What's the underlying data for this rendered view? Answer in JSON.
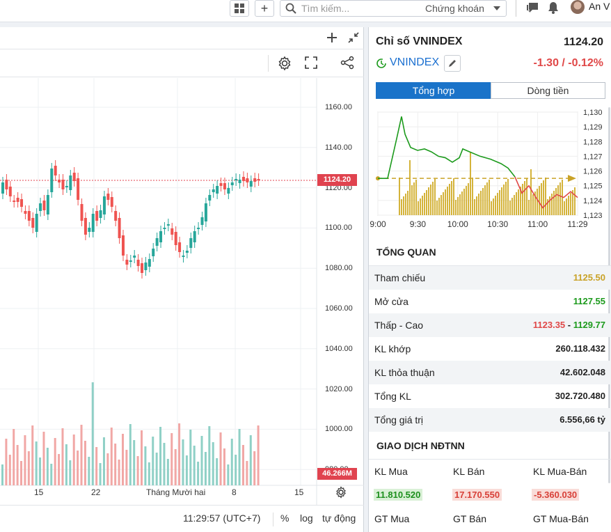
{
  "topbar": {
    "search_placeholder": "Tìm kiếm...",
    "search_scope": "Chứng khoán",
    "user_name": "An V"
  },
  "chart": {
    "price_axis": [
      "1160.00",
      "1140.00",
      "1120.00",
      "1100.00",
      "1080.00",
      "1060.00",
      "1040.00",
      "1020.00",
      "1000.00",
      "980.00"
    ],
    "last_price_label": "1124.20",
    "volume_label": "46.266M",
    "date_labels": [
      "15",
      "22",
      "Tháng Mười hai",
      "8",
      "15"
    ],
    "time_text": "11:29:57 (UTC+7)",
    "percent_label": "%",
    "log_label": "log",
    "auto_label": "tự động",
    "up_color": "#26a69a",
    "down_color": "#ef5350"
  },
  "index": {
    "title": "Chỉ số VNINDEX",
    "value": "1124.20",
    "symbol": "VNINDEX",
    "change": "-1.30 / -0.12%"
  },
  "tabs": [
    "Tổng hợp",
    "Dòng tiền"
  ],
  "intraday": {
    "y_labels": [
      "1,130",
      "1,129",
      "1,128",
      "1,127",
      "1,126",
      "1,125",
      "1,124",
      "1,123"
    ],
    "x_labels": [
      "9:00",
      "9:30",
      "10:00",
      "10:30",
      "11:00",
      "11:29"
    ],
    "reference": 1125.5
  },
  "overview": {
    "title": "TỔNG QUAN",
    "rows": [
      {
        "label": "Tham chiếu",
        "value": "1125.50"
      },
      {
        "label": "Mở cửa",
        "value": "1127.55"
      },
      {
        "label": "Thấp - Cao",
        "low": "1123.35",
        "sep": " - ",
        "high": "1129.77"
      },
      {
        "label": "KL khớp",
        "value": "260.118.432"
      },
      {
        "label": "KL thỏa thuận",
        "value": "42.602.048"
      },
      {
        "label": "Tổng KL",
        "value": "302.720.480"
      },
      {
        "label": "Tổng giá trị",
        "value": "6.556,66 tỷ"
      }
    ]
  },
  "foreign": {
    "title": "GIAO DỊCH NĐTNN",
    "headers": [
      "KL Mua",
      "KL Bán",
      "KL Mua-Bán"
    ],
    "values": [
      "11.810.520",
      "17.170.550",
      "-5.360.030"
    ],
    "headers2": [
      "GT Mua",
      "GT Bán",
      "GT Mua-Bán"
    ]
  },
  "colors": {
    "reference_yellow": "#c9a227",
    "up_green": "#1c9a1c",
    "down_red": "#e04848",
    "tab_blue": "#1a73c9"
  }
}
